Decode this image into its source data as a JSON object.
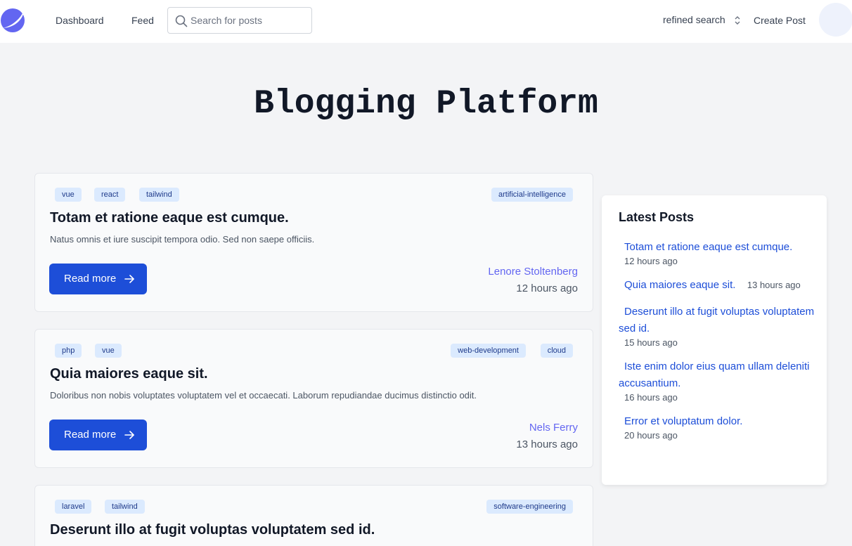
{
  "nav": {
    "dashboard": "Dashboard",
    "feed": "Feed",
    "search_placeholder": "Search for posts",
    "refined_search": "refined search",
    "create_post": "Create Post"
  },
  "page_title": "Blogging Platform",
  "posts": [
    {
      "tags_left": [
        "vue",
        "react",
        "tailwind"
      ],
      "tags_right": [
        "artificial-intelligence"
      ],
      "title": "Totam et ratione eaque est cumque.",
      "excerpt": "Natus omnis et iure suscipit tempora odio. Sed non saepe officiis.",
      "read_more": "Read more",
      "author": "Lenore Stoltenberg",
      "time": "12 hours ago"
    },
    {
      "tags_left": [
        "php",
        "vue"
      ],
      "tags_right": [
        "web-development",
        "cloud"
      ],
      "title": "Quia maiores eaque sit.",
      "excerpt": "Doloribus non nobis voluptates voluptatem vel et occaecati. Laborum repudiandae ducimus distinctio odit.",
      "read_more": "Read more",
      "author": "Nels Ferry",
      "time": "13 hours ago"
    },
    {
      "tags_left": [
        "laravel",
        "tailwind"
      ],
      "tags_right": [
        "software-engineering"
      ],
      "title": "Deserunt illo at fugit voluptas voluptatem sed id."
    }
  ],
  "sidebar": {
    "title": "Latest Posts",
    "items": [
      {
        "title": "Totam et ratione eaque est cumque.",
        "time": "12 hours ago"
      },
      {
        "title": "Quia maiores eaque sit.",
        "time": "13 hours ago"
      },
      {
        "title": "Deserunt illo at fugit voluptas voluptatem sed id.",
        "time": "15 hours ago"
      },
      {
        "title": "Iste enim dolor eius quam ullam deleniti accusantium.",
        "time": "16 hours ago"
      },
      {
        "title": "Error et voluptatum dolor.",
        "time": "20 hours ago"
      }
    ]
  },
  "colors": {
    "accent": "#1d4ed8",
    "author": "#6366f1",
    "tag_bg": "#dbeafe",
    "page_bg": "#f3f4f6"
  }
}
